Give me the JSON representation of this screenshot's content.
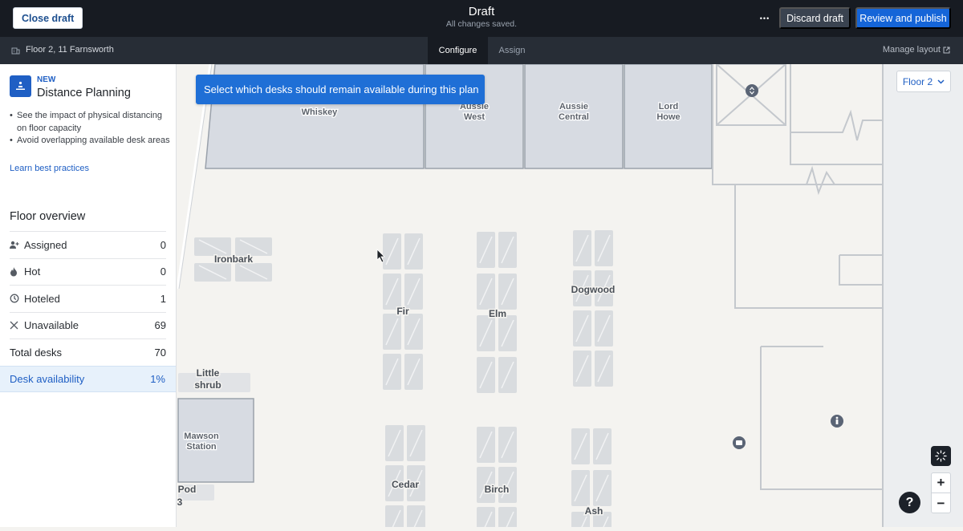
{
  "topbar": {
    "close_label": "Close draft",
    "title": "Draft",
    "subtitle": "All changes saved.",
    "more_label": "•••",
    "discard_label": "Discard draft",
    "publish_label": "Review and publish"
  },
  "subbar": {
    "location": "Floor 2, 11 Farnsworth",
    "tabs": [
      {
        "label": "Configure",
        "active": true
      },
      {
        "label": "Assign",
        "active": false
      }
    ],
    "manage_label": "Manage layout"
  },
  "sidebar": {
    "promo": {
      "badge": "NEW",
      "title": "Distance Planning",
      "bullets": [
        "See the impact of physical distancing on floor capacity",
        "Avoid overlapping available desk areas"
      ],
      "link": "Learn best practices"
    },
    "overview": {
      "title": "Floor overview",
      "rows": [
        {
          "label": "Assigned",
          "value": "0",
          "icon": "person-add-icon"
        },
        {
          "label": "Hot",
          "value": "0",
          "icon": "flame-icon"
        },
        {
          "label": "Hoteled",
          "value": "1",
          "icon": "clock-icon"
        },
        {
          "label": "Unavailable",
          "value": "69",
          "icon": "x-icon"
        }
      ],
      "total": {
        "label": "Total desks",
        "value": "70"
      },
      "availability": {
        "label": "Desk availability",
        "value": "1%"
      }
    }
  },
  "map": {
    "tooltip": "Select which desks should remain available during this plan",
    "floor_select": "Floor 2",
    "rooms": {
      "whiskey": "Whiskey",
      "aussie_west_1": "Aussie",
      "aussie_west_2": "West",
      "aussie_central_1": "Aussie",
      "aussie_central_2": "Central",
      "lord_howe_1": "Lord",
      "lord_howe_2": "Howe",
      "mawson_1": "Mawson",
      "mawson_2": "Station"
    },
    "neighborhoods": {
      "ironbark": "Ironbark",
      "fir": "Fir",
      "elm": "Elm",
      "dogwood": "Dogwood",
      "little_shrub_1": "Little",
      "little_shrub_2": "shrub",
      "cedar": "Cedar",
      "birch": "Birch",
      "ash": "Ash",
      "pod_1": "Pod",
      "pod_2": "3"
    },
    "zoom_in": "+",
    "zoom_out": "−",
    "help": "?"
  }
}
